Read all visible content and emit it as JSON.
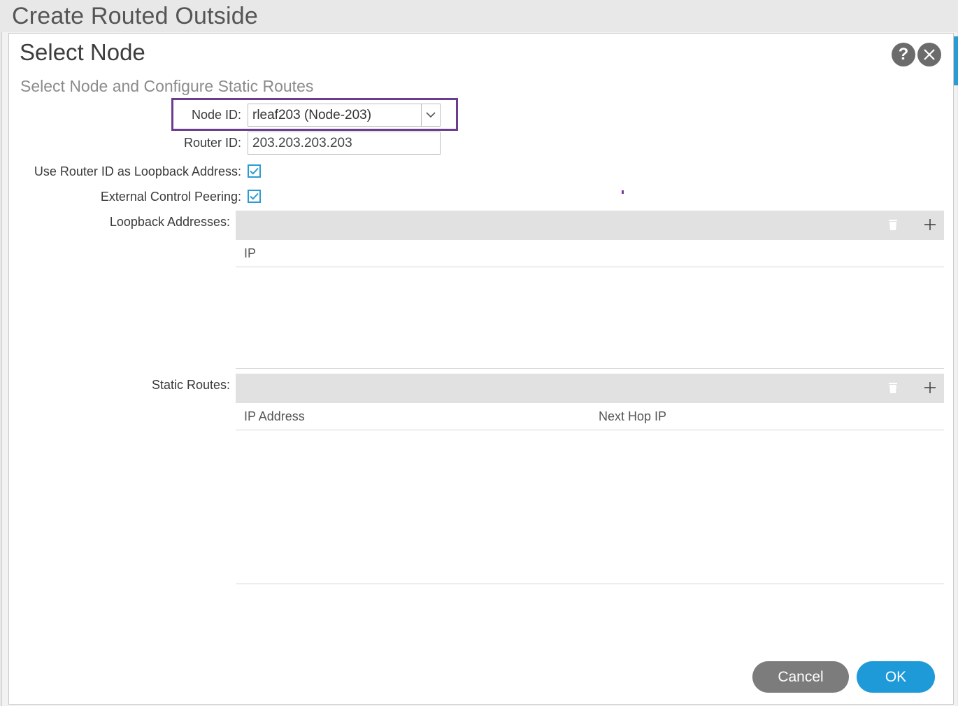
{
  "window": {
    "title": "Create Routed Outside"
  },
  "dialog": {
    "title": "Select Node",
    "subtitle": "Select Node and Configure Static Routes",
    "help_icon": "question-icon",
    "close_icon": "close-icon"
  },
  "form": {
    "node_id": {
      "label": "Node ID:",
      "value": "rleaf203 (Node-203)"
    },
    "router_id": {
      "label": "Router ID:",
      "value": "203.203.203.203"
    },
    "use_router_id_loopback": {
      "label": "Use Router ID as Loopback Address:",
      "checked": true
    },
    "external_control_peering": {
      "label": "External Control Peering:",
      "checked": true
    }
  },
  "loopback_table": {
    "label": "Loopback Addresses:",
    "columns": [
      "IP"
    ],
    "rows": []
  },
  "static_routes_table": {
    "label": "Static Routes:",
    "columns": [
      "IP Address",
      "Next Hop IP"
    ],
    "rows": []
  },
  "footer": {
    "cancel_label": "Cancel",
    "ok_label": "OK"
  },
  "colors": {
    "accent": "#1e9ad9",
    "highlight": "#6b3d8e",
    "cancel": "#7c7c7c"
  }
}
